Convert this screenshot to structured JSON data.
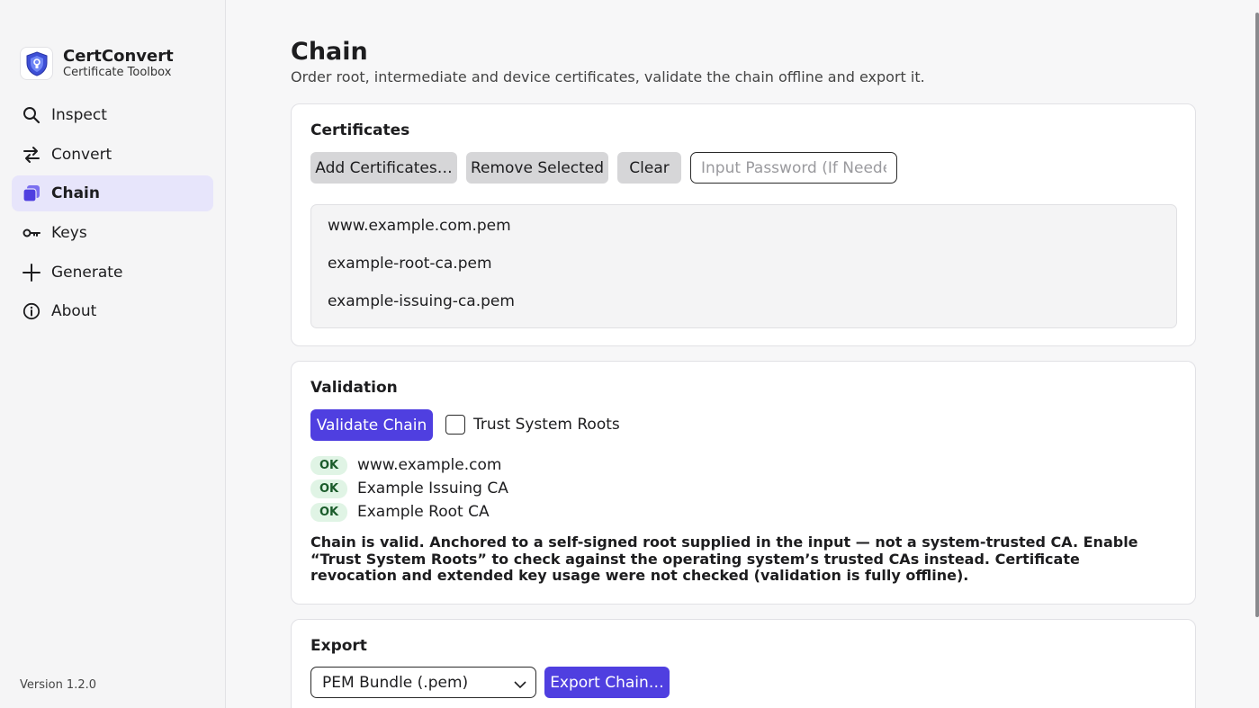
{
  "app": {
    "name": "CertConvert",
    "subtitle": "Certificate Toolbox",
    "version": "Version 1.2.0"
  },
  "nav": [
    {
      "label": "Inspect",
      "icon": "search-icon"
    },
    {
      "label": "Convert",
      "icon": "swap-arrows-icon"
    },
    {
      "label": "Chain",
      "icon": "stack-icon",
      "active": true
    },
    {
      "label": "Keys",
      "icon": "key-icon"
    },
    {
      "label": "Generate",
      "icon": "plus-icon"
    },
    {
      "label": "About",
      "icon": "info-icon"
    }
  ],
  "page": {
    "title": "Chain",
    "subtitle": "Order root, intermediate and device certificates, validate the chain offline and export it."
  },
  "certificates": {
    "title": "Certificates",
    "add_label": "Add Certificates…",
    "remove_label": "Remove Selected",
    "clear_label": "Clear",
    "password_placeholder": "Input Password (If Needed)",
    "items": [
      "www.example.com.pem",
      "example-root-ca.pem",
      "example-issuing-ca.pem"
    ]
  },
  "validation": {
    "title": "Validation",
    "validate_label": "Validate Chain",
    "trust_label": "Trust System Roots",
    "trust_checked": false,
    "results": [
      {
        "status": "OK",
        "name": "www.example.com"
      },
      {
        "status": "OK",
        "name": "Example Issuing CA"
      },
      {
        "status": "OK",
        "name": "Example Root CA"
      }
    ],
    "message": "Chain is valid. Anchored to a self-signed root supplied in the input — not a system-trusted CA. Enable “Trust System Roots” to check against the operating system’s trusted CAs instead. Certificate revocation and extended key usage were not checked (validation is fully offline)."
  },
  "export": {
    "title": "Export",
    "format_selected": "PEM Bundle (.pem)",
    "export_label": "Export Chain…"
  },
  "colors": {
    "accent": "#4f3fe0",
    "active_nav_bg": "#e7e5fb",
    "ok_badge_bg": "#e0f4e5"
  }
}
